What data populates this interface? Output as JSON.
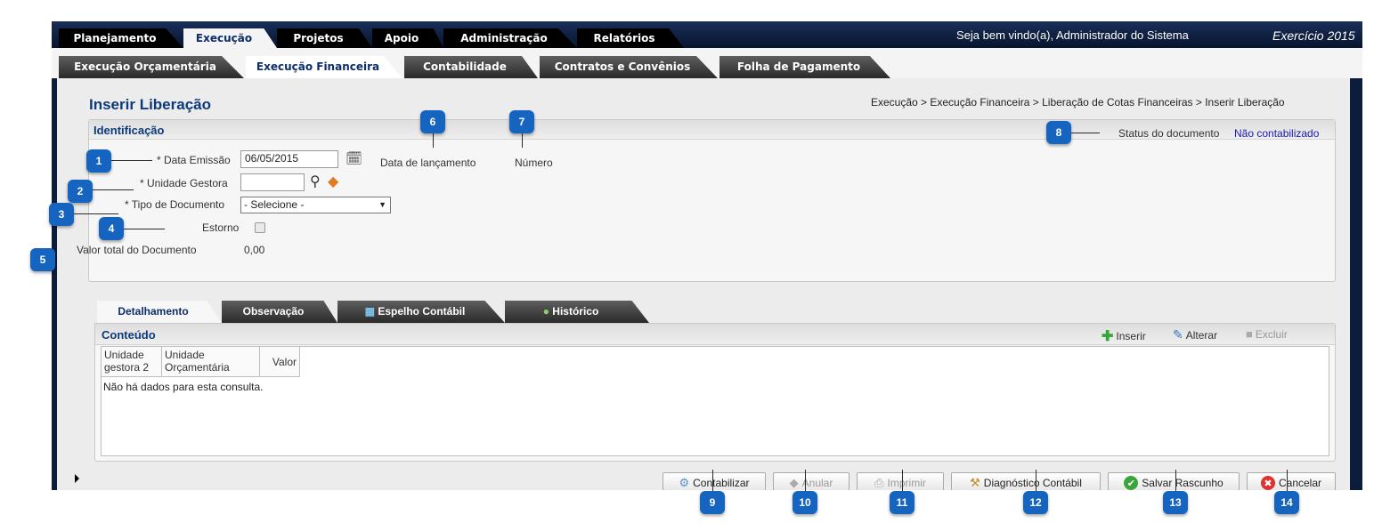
{
  "top_nav": {
    "tabs": [
      "Planejamento",
      "Execução",
      "Projetos",
      "Apoio",
      "Administração",
      "Relatórios"
    ],
    "active": "Execução",
    "welcome": "Seja bem vindo(a), Administrador do Sistema",
    "exercise": "Exercício 2015"
  },
  "sub_nav": {
    "tabs": [
      "Execução Orçamentária",
      "Execução Financeira",
      "Contabilidade",
      "Contratos e Convênios",
      "Folha de Pagamento"
    ],
    "active": "Execução Financeira"
  },
  "page": {
    "title": "Inserir Liberação",
    "breadcrumb": "Execução > Execução Financeira > Liberação de Cotas Financeiras > Inserir Liberação"
  },
  "identificacao": {
    "title": "Identificação",
    "data_emissao_label": "* Data Emissão",
    "data_emissao_value": "06/05/2015",
    "data_lancamento_label": "Data de lançamento",
    "numero_label": "Número",
    "status_label": "Status do documento",
    "status_value": "Não contabilizado",
    "unidade_gestora_label": "* Unidade Gestora",
    "unidade_gestora_value": "",
    "tipo_documento_label": "* Tipo de Documento",
    "tipo_documento_value": "- Selecione -",
    "estorno_label": "Estorno",
    "valor_total_label": "Valor total do Documento",
    "valor_total_value": "0,00"
  },
  "detail_tabs": [
    "Detalhamento",
    "Observação",
    "Espelho Contábil",
    "Histórico"
  ],
  "conteudo": {
    "title": "Conteúdo",
    "tools": {
      "inserir": "Inserir",
      "alterar": "Alterar",
      "excluir": "Excluir"
    },
    "columns": [
      "Unidade gestora 2",
      "Unidade Orçamentária",
      "Valor"
    ],
    "empty_text": "Não há dados para esta consulta."
  },
  "buttons": {
    "contabilizar": "Contabilizar",
    "anular": "Anular",
    "imprimir": "Imprimir",
    "diagnostico": "Diagnóstico Contábil",
    "salvar": "Salvar Rascunho",
    "cancelar": "Cancelar"
  },
  "callouts": [
    "1",
    "2",
    "3",
    "4",
    "5",
    "6",
    "7",
    "8",
    "9",
    "10",
    "11",
    "12",
    "13",
    "14"
  ],
  "icons": {
    "calendar": "calendar-clock-icon",
    "search": "magnifier-icon",
    "eraser": "eraser-icon",
    "grid": "table-icon",
    "history": "history-icon",
    "insert": "plus-icon",
    "edit": "edit-icon",
    "delete": "trash-icon"
  },
  "colors": {
    "navy": "#0b1d3a",
    "title_blue": "#0d3a7a",
    "callout_blue": "#1565c0",
    "status_link": "#1a1ab0"
  }
}
